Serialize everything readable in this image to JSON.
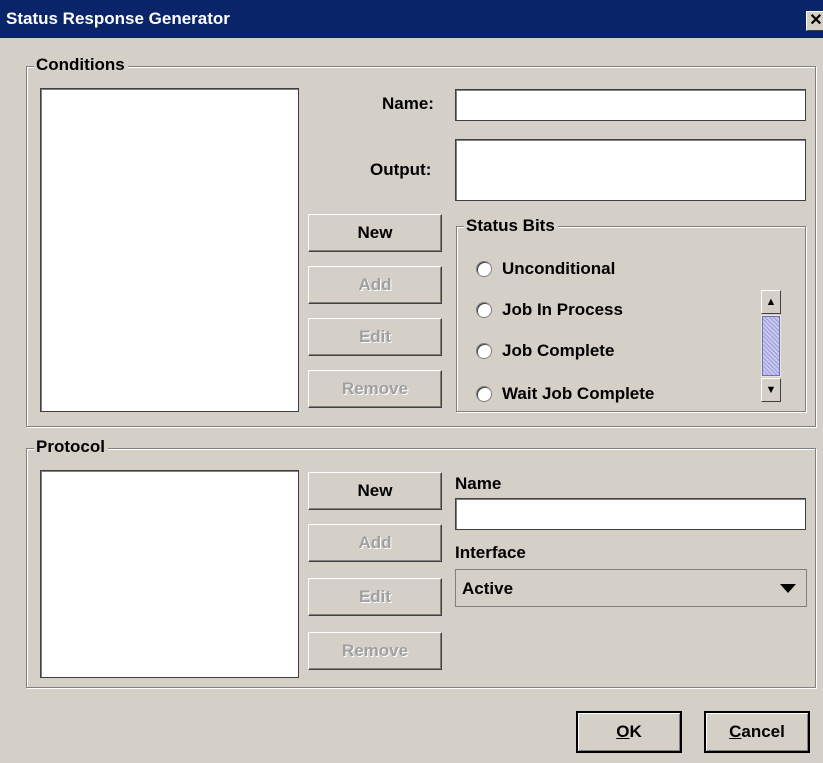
{
  "window": {
    "title": "Status Response Generator",
    "close_glyph": "✕"
  },
  "conditions": {
    "legend": "Conditions",
    "name_label": "Name:",
    "name_value": "",
    "output_label": "Output:",
    "output_value": "",
    "buttons": {
      "new": "New",
      "add": "Add",
      "edit": "Edit",
      "remove": "Remove"
    },
    "status_bits": {
      "legend": "Status Bits",
      "items": [
        "Unconditional",
        "Job In Process",
        "Job Complete",
        "Wait Job Complete"
      ]
    }
  },
  "protocol": {
    "legend": "Protocol",
    "name_label": "Name",
    "name_value": "",
    "interface_label": "Interface",
    "interface_value": "Active",
    "buttons": {
      "new": "New",
      "add": "Add",
      "edit": "Edit",
      "remove": "Remove"
    }
  },
  "footer": {
    "ok_mnemonic": "O",
    "ok_rest": "K",
    "cancel_mnemonic": "C",
    "cancel_rest": "ancel"
  },
  "icons": {
    "radio": "radio-button-icon",
    "scroll_up": "scroll-up-icon",
    "scroll_down": "scroll-down-icon",
    "dropdown": "chevron-down-icon",
    "close": "close-icon"
  }
}
